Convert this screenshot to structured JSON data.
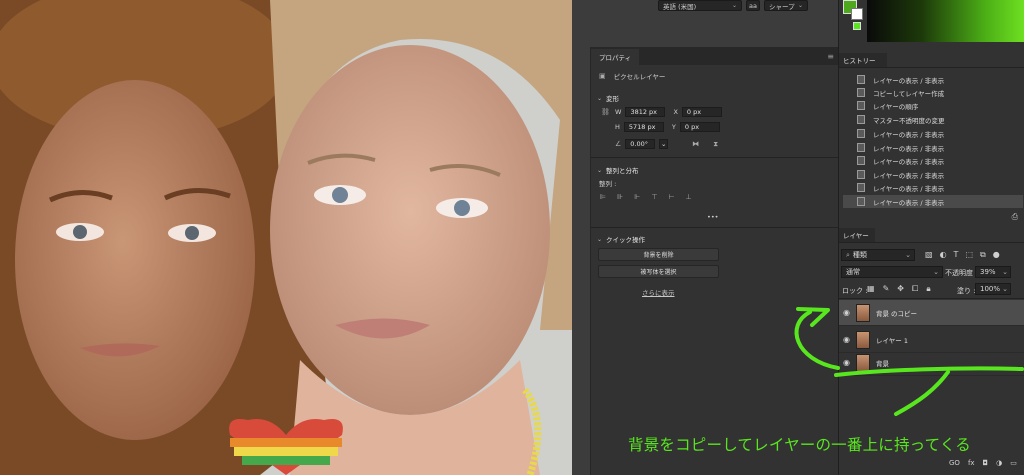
{
  "top_options": {
    "language": "英語 (米国)",
    "aa_icon": "aa",
    "antialias": "シャープ"
  },
  "properties": {
    "tab": "プロパティ",
    "layer_type": "ピクセルレイヤー",
    "transform": {
      "title": "変形",
      "w_label": "W",
      "w": "3812 px",
      "h_label": "H",
      "h": "5718 px",
      "x_label": "X",
      "x": "0 px",
      "y_label": "Y",
      "y": "0 px",
      "angle": "0.00°"
    },
    "align": {
      "title": "整列と分布",
      "label": "整列 :",
      "more": "•••"
    },
    "quick": {
      "title": "クイック操作",
      "remove_bg": "背景を削除",
      "select_subject": "被写体を選択",
      "show_more": "さらに表示"
    }
  },
  "history": {
    "tab": "ヒストリー",
    "items": [
      "レイヤーの表示 / 非表示",
      "コピーしてレイヤー作成",
      "レイヤーの順序",
      "マスター不透明度の変更",
      "レイヤーの表示 / 非表示",
      "レイヤーの表示 / 非表示",
      "レイヤーの表示 / 非表示",
      "レイヤーの表示 / 非表示",
      "レイヤーの表示 / 非表示",
      "レイヤーの表示 / 非表示"
    ]
  },
  "layers": {
    "tab": "レイヤー",
    "kind": "種類",
    "blend_mode": "通常",
    "opacity_label": "不透明度 :",
    "opacity": "39%",
    "lock_label": "ロック :",
    "fill_label": "塗り :",
    "fill": "100%",
    "items": [
      "背景 のコピー",
      "レイヤー 1",
      "背景"
    ],
    "footer": [
      "GO",
      "fx"
    ]
  },
  "annotation": "背景をコピーしてレイヤーの一番上に持ってくる",
  "colors": {
    "annotation_green": "#58e71e",
    "panel": "#323232"
  }
}
